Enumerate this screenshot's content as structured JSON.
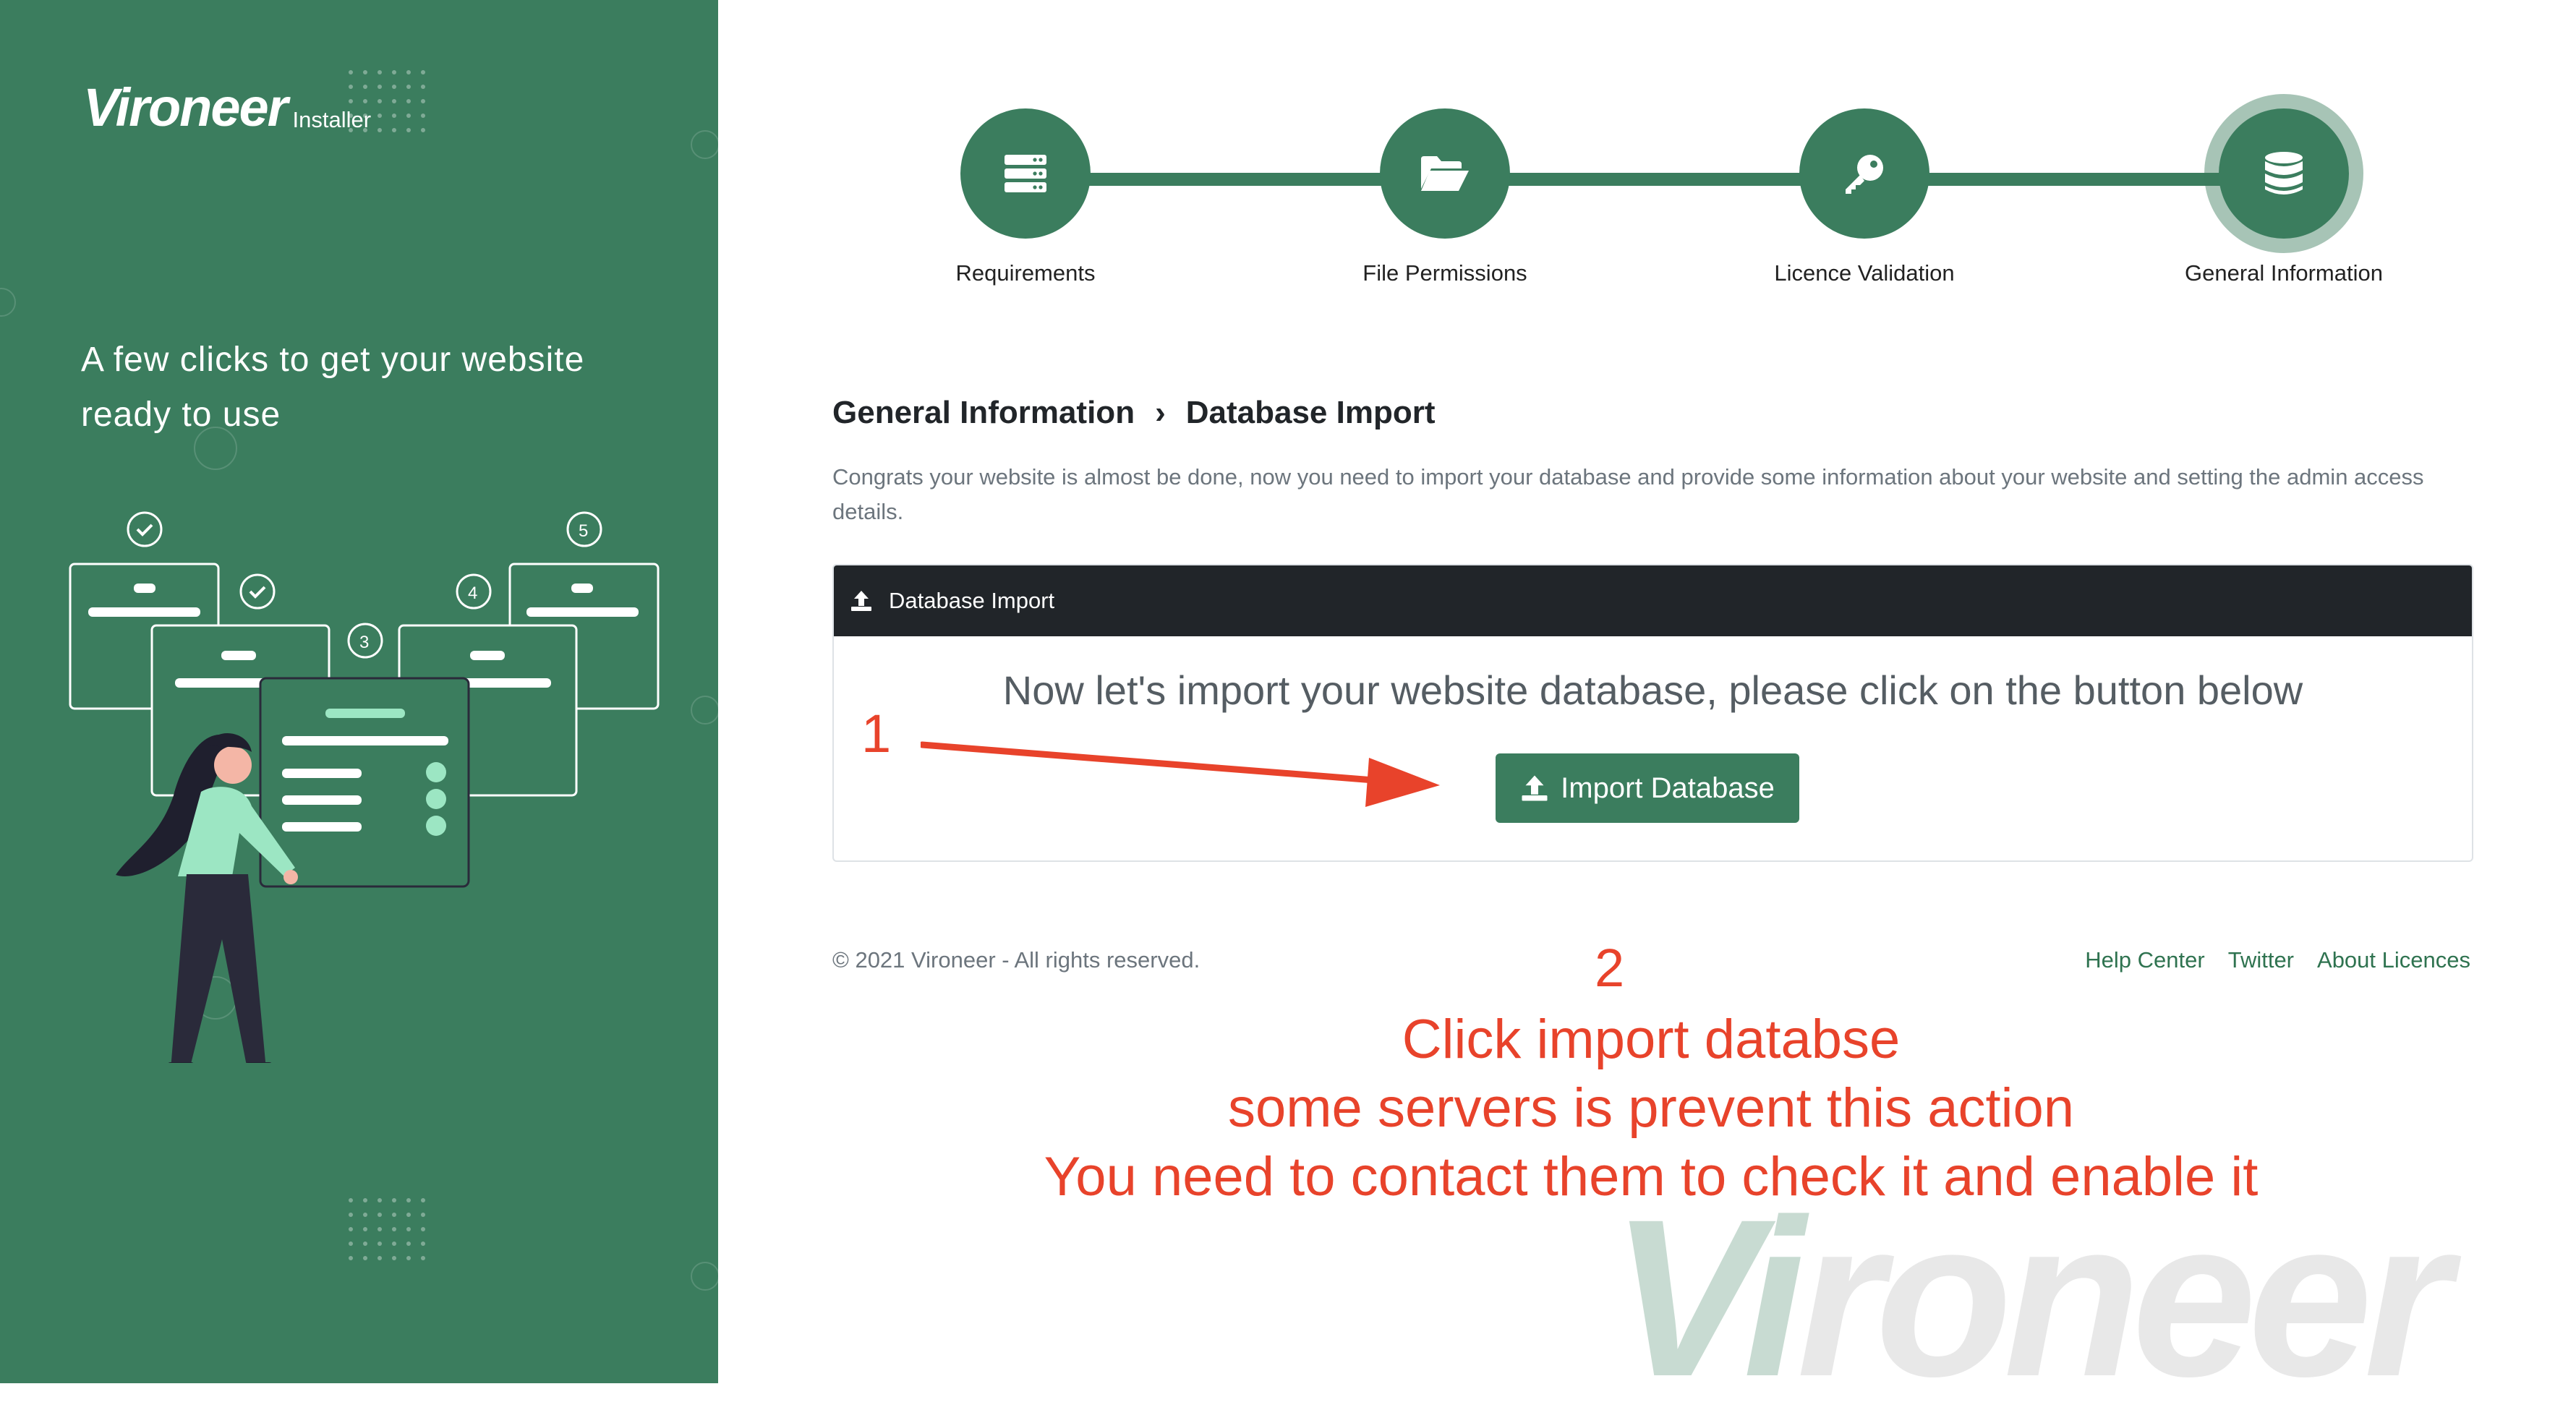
{
  "brand": {
    "name": "Vironeer",
    "sub": "Installer"
  },
  "sidebar": {
    "tagline": "A few clicks to get your website ready to use"
  },
  "steps": [
    {
      "label": "Requirements",
      "icon": "server-icon",
      "active": false
    },
    {
      "label": "File Permissions",
      "icon": "folder-open-icon",
      "active": false
    },
    {
      "label": "Licence Validation",
      "icon": "key-icon",
      "active": false
    },
    {
      "label": "General Information",
      "icon": "database-icon",
      "active": true
    }
  ],
  "breadcrumb": {
    "parent": "General Information",
    "separator": "›",
    "current": "Database Import"
  },
  "intro": "Congrats your website is almost be done, now you need to import your database and provide some information about your website and setting the admin access details.",
  "card": {
    "header": "Database Import",
    "header_icon": "upload-icon",
    "message": "Now let's import your website database, please click on the button below",
    "button_label": "Import Database",
    "button_icon": "upload-icon"
  },
  "footer": {
    "copyright": "© 2021 Vironeer - All rights reserved.",
    "links": [
      "Help Center",
      "Twitter",
      "About Licences"
    ]
  },
  "annotations": {
    "step1": "1",
    "step2": "2",
    "lines": [
      "Click import databse",
      "some servers is prevent this action",
      "You need to contact them to check it and enable it"
    ]
  },
  "watermark": {
    "part1": "Vi",
    "part2": "roneer"
  },
  "colors": {
    "brand_green": "#3b7d5e",
    "dark": "#212529",
    "annotation_red": "#e8432b",
    "accent_mint": "#9ce6c3"
  }
}
